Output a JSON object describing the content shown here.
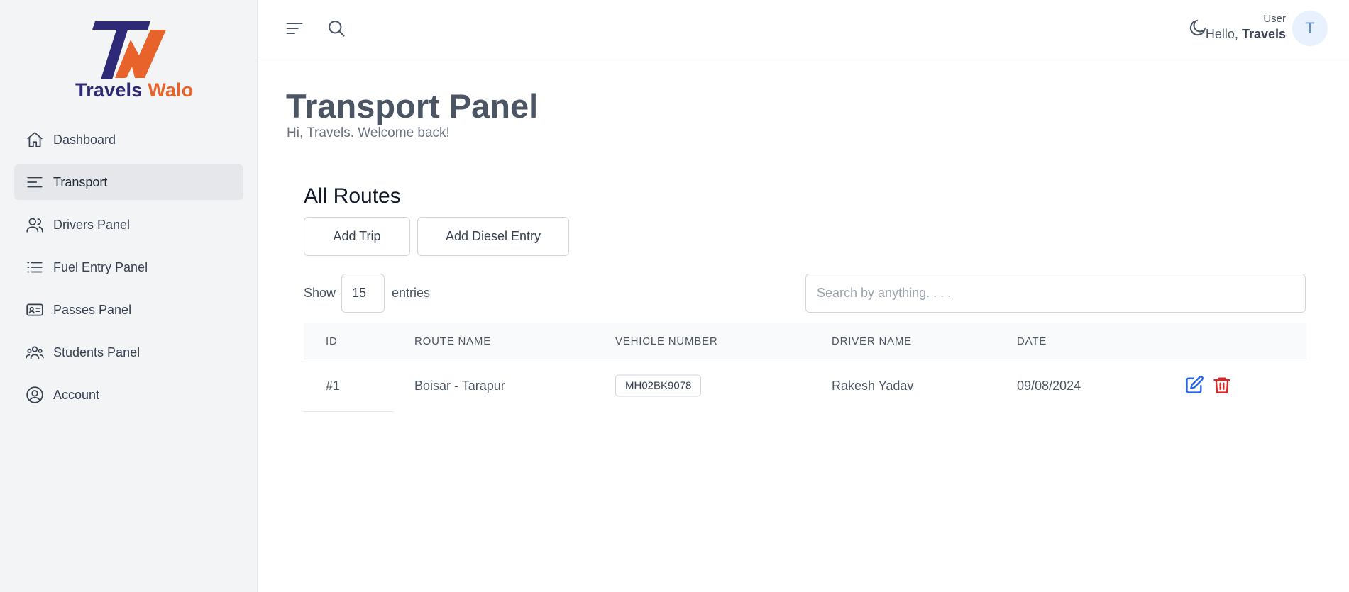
{
  "brand": {
    "name_part1": "Travels",
    "name_part2": "Walo",
    "color_primary": "#2e2a78",
    "color_accent": "#e8632b"
  },
  "sidebar": {
    "items": [
      {
        "label": "Dashboard",
        "icon": "home-icon",
        "active": false
      },
      {
        "label": "Transport",
        "icon": "menu-lines-icon",
        "active": true
      },
      {
        "label": "Drivers Panel",
        "icon": "users-icon",
        "active": false
      },
      {
        "label": "Fuel Entry Panel",
        "icon": "list-icon",
        "active": false
      },
      {
        "label": "Passes Panel",
        "icon": "id-card-icon",
        "active": false
      },
      {
        "label": "Students Panel",
        "icon": "group-icon",
        "active": false
      },
      {
        "label": "Account",
        "icon": "user-circle-icon",
        "active": false
      }
    ]
  },
  "topbar": {
    "user_role": "User",
    "hello": "Hello,",
    "user_name": "Travels",
    "avatar_initial": "T"
  },
  "main": {
    "title": "Transport Panel",
    "subtitle": "Hi, Travels. Welcome back!",
    "section_title": "All Routes",
    "add_trip_label": "Add Trip",
    "add_diesel_label": "Add Diesel Entry",
    "show_label": "Show",
    "entries_value": "15",
    "entries_label": "entries",
    "search_placeholder": "Search by anything. . . ."
  },
  "table": {
    "headers": [
      "ID",
      "ROUTE NAME",
      "VEHICLE NUMBER",
      "DRIVER NAME",
      "DATE"
    ],
    "rows": [
      {
        "id": "#1",
        "route": "Boisar - Tarapur",
        "vehicle": "MH02BK9078",
        "driver": "Rakesh Yadav",
        "date": "09/08/2024"
      }
    ]
  },
  "colors": {
    "edit": "#2563eb",
    "delete": "#dc2626"
  }
}
